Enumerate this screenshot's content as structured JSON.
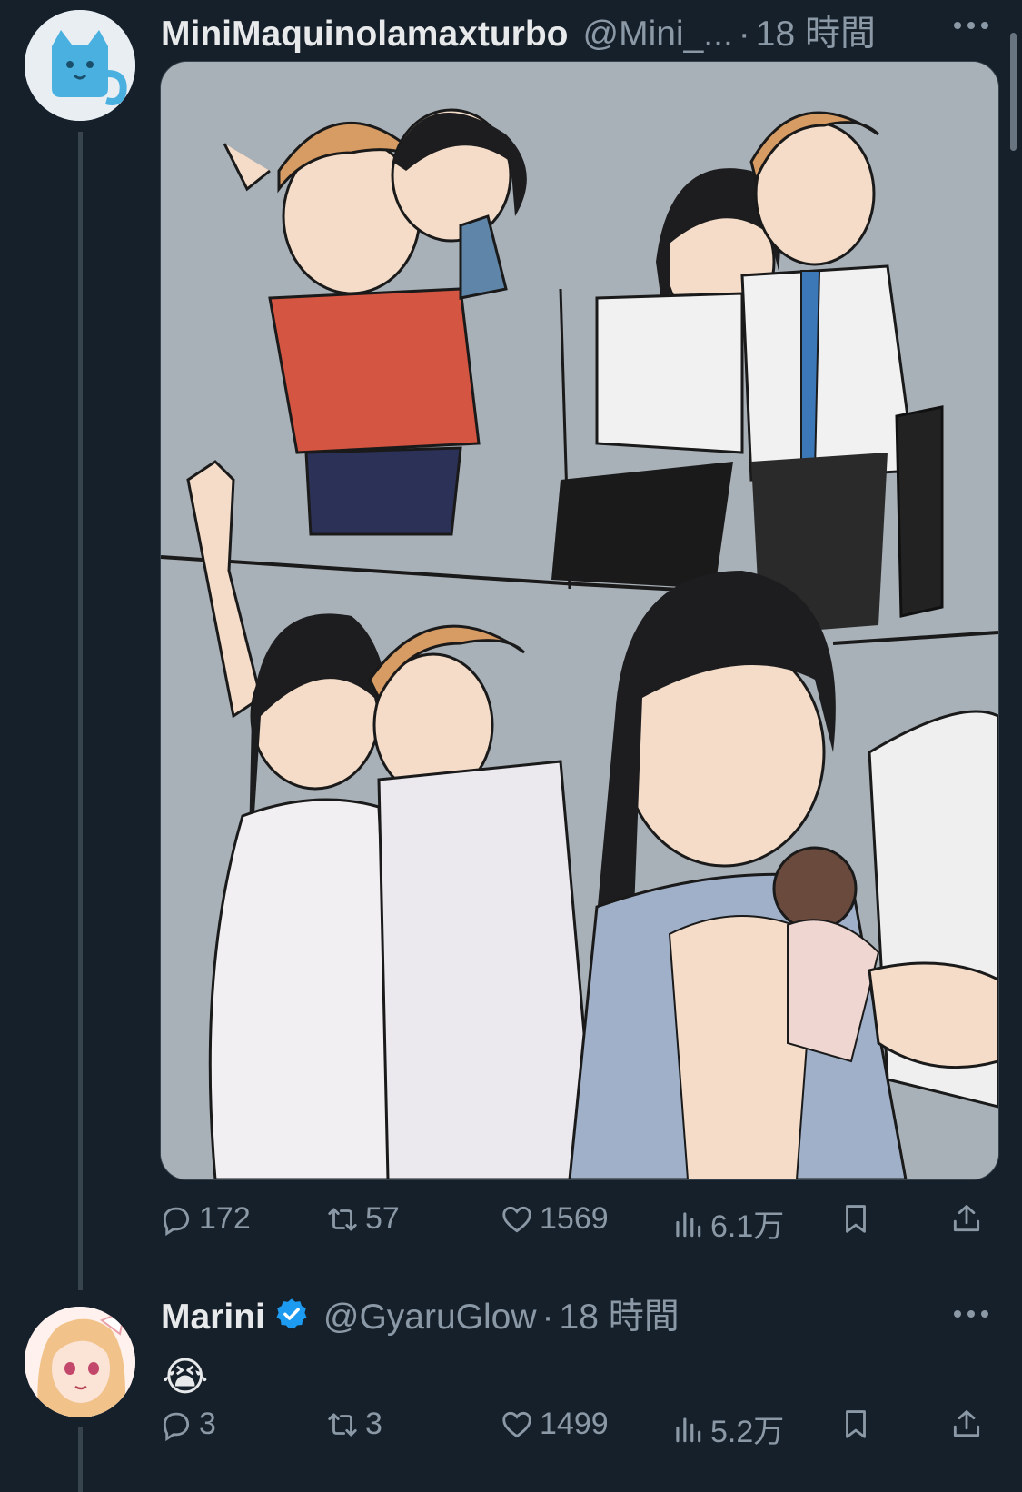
{
  "tweets": [
    {
      "display_name": "MiniMaquinolamaxturbo",
      "handle": "@Mini_...",
      "separator": "·",
      "time": "18 時間",
      "media_alt": "illustration",
      "actions": {
        "replies": "172",
        "retweets": "57",
        "likes": "1569",
        "views": "6.1万"
      }
    },
    {
      "display_name": "Marini",
      "handle": "@GyaruGlow",
      "separator": "·",
      "time": "18 時間",
      "text": "😭",
      "actions": {
        "replies": "3",
        "retweets": "3",
        "likes": "1499",
        "views": "5.2万"
      }
    }
  ],
  "colors": {
    "background": "#15202b",
    "secondary_text": "#8b98a5",
    "verified": "#1d9bf0"
  },
  "icons": [
    "reply-icon",
    "retweet-icon",
    "like-icon",
    "views-icon",
    "bookmark-icon",
    "share-icon",
    "more-icon",
    "verified-badge-icon"
  ]
}
